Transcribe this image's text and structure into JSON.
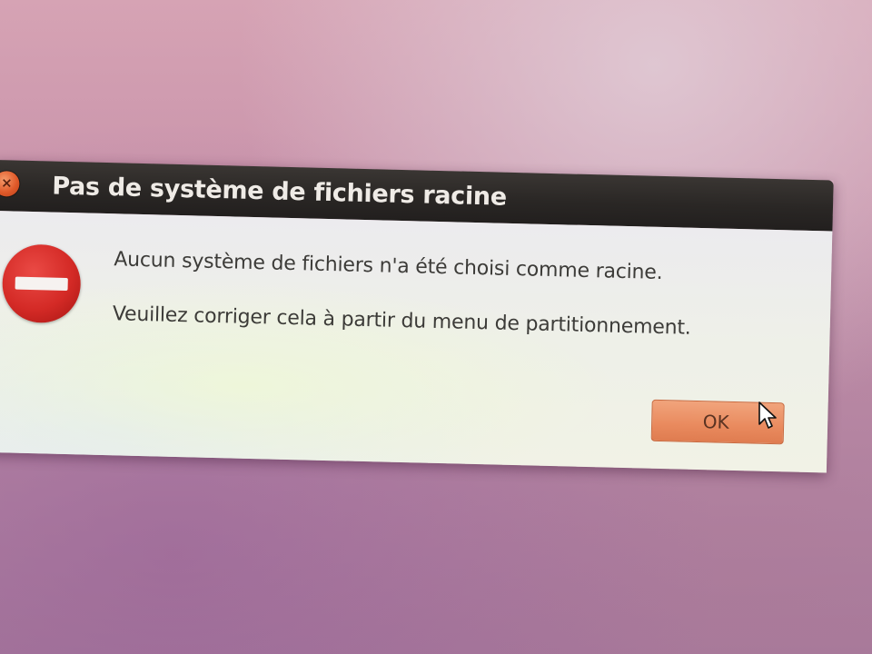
{
  "window": {
    "title": "Pas de système de fichiers racine",
    "close_icon": "close-icon"
  },
  "dialog": {
    "icon": "error-stop-icon",
    "message_primary": "Aucun système de fichiers n'a été choisi comme racine.",
    "message_secondary": "Veuillez corriger cela à partir du menu de partitionnement.",
    "ok_label": "OK"
  },
  "colors": {
    "titlebar": "#2a2725",
    "title_text": "#efebe6",
    "close_button": "#e05a2a",
    "error_icon": "#d42a26",
    "ok_button": "#e98a5e",
    "desktop": "#c994ab"
  }
}
